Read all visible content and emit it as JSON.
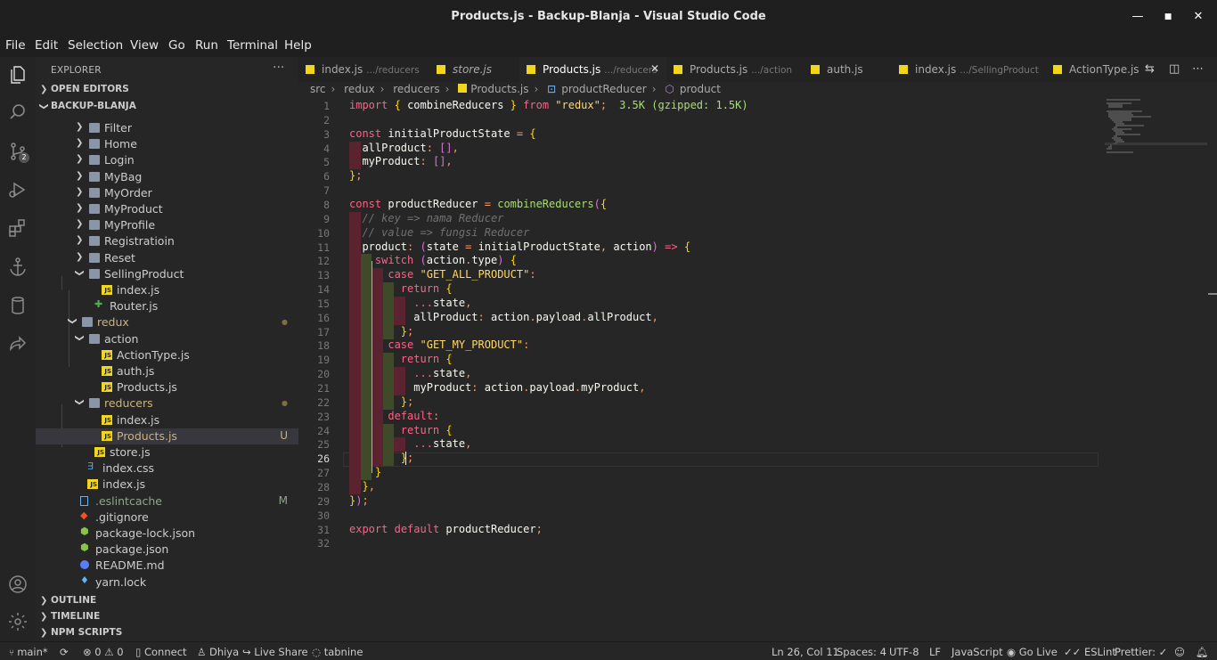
{
  "window": {
    "title": "Products.js - Backup-Blanja - Visual Studio Code",
    "minimize": "—",
    "maximize": "■",
    "close": "✕"
  },
  "menu": [
    "File",
    "Edit",
    "Selection",
    "View",
    "Go",
    "Run",
    "Terminal",
    "Help"
  ],
  "activity": {
    "items": [
      "explorer-icon",
      "search-icon",
      "source-control-icon",
      "run-debug-icon",
      "extensions-icon",
      "anchor-icon",
      "database-icon",
      "live-share-icon"
    ],
    "scm_badge": "2",
    "bottom": [
      "account-icon",
      "gear-icon"
    ]
  },
  "sidebar": {
    "title": "EXPLORER",
    "more": "···",
    "sections": {
      "open_editors": "OPEN EDITORS",
      "workspace": "BACKUP-BLANJA",
      "outline": "OUTLINE",
      "timeline": "TIMELINE",
      "npm": "NPM SCRIPTS"
    },
    "tree": [
      {
        "name": "Filter",
        "type": "folder",
        "depth": 2,
        "open": false
      },
      {
        "name": "Home",
        "type": "folder",
        "depth": 2,
        "open": false
      },
      {
        "name": "Login",
        "type": "folder",
        "depth": 2,
        "open": false
      },
      {
        "name": "MyBag",
        "type": "folder",
        "depth": 2,
        "open": false
      },
      {
        "name": "MyOrder",
        "type": "folder",
        "depth": 2,
        "open": false
      },
      {
        "name": "MyProduct",
        "type": "folder",
        "depth": 2,
        "open": false
      },
      {
        "name": "MyProfile",
        "type": "folder",
        "depth": 2,
        "open": false
      },
      {
        "name": "Registratioin",
        "type": "folder",
        "depth": 2,
        "open": false
      },
      {
        "name": "Reset",
        "type": "folder",
        "depth": 2,
        "open": false
      },
      {
        "name": "SellingProduct",
        "type": "folder",
        "depth": 2,
        "open": true
      },
      {
        "name": "index.js",
        "type": "js",
        "depth": 3
      },
      {
        "name": "Router.js",
        "type": "router",
        "depth": 2
      },
      {
        "name": "redux",
        "type": "folder",
        "depth": 1,
        "open": true,
        "color": "#c9b47a",
        "badge": "●"
      },
      {
        "name": "action",
        "type": "folder",
        "depth": 2,
        "open": true
      },
      {
        "name": "ActionType.js",
        "type": "js",
        "depth": 3
      },
      {
        "name": "auth.js",
        "type": "js",
        "depth": 3
      },
      {
        "name": "Products.js",
        "type": "js",
        "depth": 3
      },
      {
        "name": "reducers",
        "type": "folder",
        "depth": 2,
        "open": true,
        "color": "#c9b47a",
        "badge": "●"
      },
      {
        "name": "index.js",
        "type": "js",
        "depth": 3
      },
      {
        "name": "Products.js",
        "type": "js",
        "depth": 3,
        "color": "#c9b47a",
        "badge": "U",
        "selected": true
      },
      {
        "name": "store.js",
        "type": "js",
        "depth": 2
      },
      {
        "name": "index.css",
        "type": "css",
        "depth": 1
      },
      {
        "name": "index.js",
        "type": "js",
        "depth": 1
      },
      {
        "name": ".eslintcache",
        "type": "file",
        "depth": 0,
        "color": "#8fa88a",
        "badge": "M"
      },
      {
        "name": ".gitignore",
        "type": "git",
        "depth": 0
      },
      {
        "name": "package-lock.json",
        "type": "npm",
        "depth": 0
      },
      {
        "name": "package.json",
        "type": "npm",
        "depth": 0
      },
      {
        "name": "README.md",
        "type": "info",
        "depth": 0
      },
      {
        "name": "yarn.lock",
        "type": "yarn",
        "depth": 0
      }
    ]
  },
  "tabs": [
    {
      "name": "index.js",
      "path": ".../reducers",
      "active": false
    },
    {
      "name": "store.js",
      "path": "",
      "active": false,
      "italic": true
    },
    {
      "name": "Products.js",
      "path": ".../reducers",
      "active": true,
      "close": "✕"
    },
    {
      "name": "Products.js",
      "path": ".../action",
      "active": false
    },
    {
      "name": "auth.js",
      "path": "",
      "active": false
    },
    {
      "name": "index.js",
      "path": ".../SellingProduct",
      "active": false
    },
    {
      "name": "ActionType.js",
      "path": "",
      "active": false
    }
  ],
  "tab_actions": [
    "compare-icon",
    "split-editor-icon",
    "more-icon"
  ],
  "breadcrumb": [
    "src",
    "redux",
    "reducers",
    "Products.js",
    "productReducer",
    "product"
  ],
  "editor": {
    "current_line": 26,
    "lines": [
      "import { combineReducers } from \"redux\";",
      "",
      "const initialProductState = {",
      "  allProduct: [],",
      "  myProduct: [],",
      "};",
      "",
      "const productReducer = combineReducers({",
      "  // key => nama Reducer",
      "  // value => fungsi Reducer",
      "  product: (state = initialProductState, action) => {",
      "    switch (action.type) {",
      "      case \"GET_ALL_PRODUCT\":",
      "        return {",
      "          ...state,",
      "          allProduct: action.payload.allProduct,",
      "        };",
      "      case \"GET_MY_PRODUCT\":",
      "        return {",
      "          ...state,",
      "          myProduct: action.payload.myProduct,",
      "        };",
      "      default:",
      "        return {",
      "          ...state,",
      "        };",
      "    }",
      "  },",
      "});",
      "",
      "export default productReducer;",
      ""
    ],
    "import_cost": "3.5K (gzipped: 1.5K)"
  },
  "status": {
    "branch": "main*",
    "sync": "⟳",
    "errors": "0",
    "warnings": "0",
    "connect": "Connect",
    "user": "Dhiya",
    "live_share": "Live Share",
    "tabnine": "tabnine",
    "position": "Ln 26, Col 11",
    "spaces": "Spaces: 4",
    "encoding": "UTF-8",
    "eol": "LF",
    "language": "JavaScript",
    "go_live": "Go Live",
    "eslint": "ESLint",
    "prettier": "Prettier: ✓"
  }
}
